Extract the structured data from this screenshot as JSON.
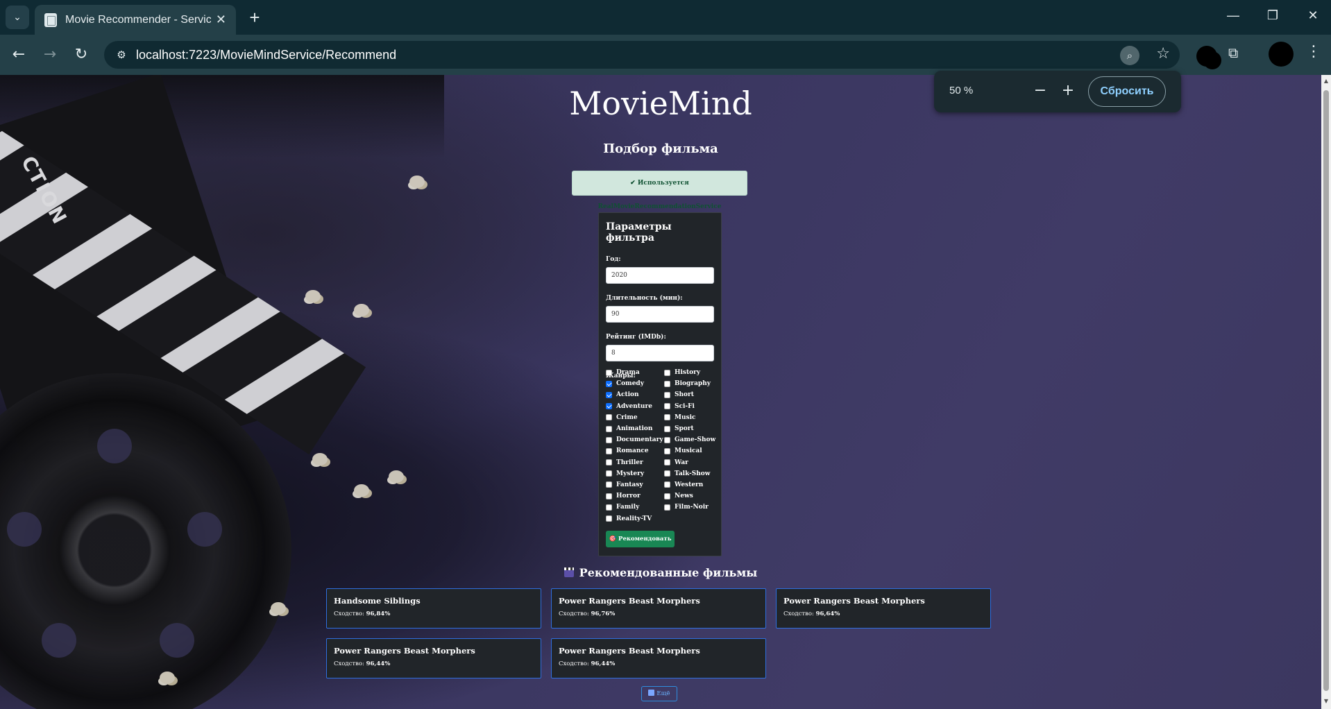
{
  "browser": {
    "tab_title": "Movie Recommender - ServiceS",
    "tab_close": "✕",
    "new_tab": "+",
    "url": "localhost:7223/MovieMindService/Recommend",
    "window": {
      "minimize": "—",
      "restore": "❐",
      "close": "✕"
    },
    "nav": {
      "back": "←",
      "forward": "→",
      "reload": "↻"
    },
    "zoom_popup": {
      "level": "50 %",
      "minus": "−",
      "plus": "+",
      "reset": "Сбросить"
    }
  },
  "page": {
    "app_title": "MovieMind",
    "section_title": "Подбор фильма",
    "service_note": "✔ Используется RealMovieRecommendationService",
    "filter": {
      "title": "Параметры фильтра",
      "year_label": "Год:",
      "year_value": "2020",
      "duration_label": "Длительность (мин):",
      "duration_value": "90",
      "rating_label": "Рейтинг (IMDb):",
      "rating_value": "8",
      "genres_label": "Жанры:",
      "genres_left": [
        {
          "name": "Drama",
          "checked": false
        },
        {
          "name": "Comedy",
          "checked": true
        },
        {
          "name": "Action",
          "checked": true
        },
        {
          "name": "Adventure",
          "checked": true
        },
        {
          "name": "Crime",
          "checked": false
        },
        {
          "name": "Animation",
          "checked": false
        },
        {
          "name": "Documentary",
          "checked": false
        },
        {
          "name": "Romance",
          "checked": false
        },
        {
          "name": "Thriller",
          "checked": false
        },
        {
          "name": "Mystery",
          "checked": false
        },
        {
          "name": "Fantasy",
          "checked": false
        },
        {
          "name": "Horror",
          "checked": false
        },
        {
          "name": "Family",
          "checked": false
        },
        {
          "name": "Reality-TV",
          "checked": false
        }
      ],
      "genres_right": [
        {
          "name": "History",
          "checked": false
        },
        {
          "name": "Biography",
          "checked": false
        },
        {
          "name": "Short",
          "checked": false
        },
        {
          "name": "Sci-Fi",
          "checked": false
        },
        {
          "name": "Music",
          "checked": false
        },
        {
          "name": "Sport",
          "checked": false
        },
        {
          "name": "Game-Show",
          "checked": false
        },
        {
          "name": "Musical",
          "checked": false
        },
        {
          "name": "War",
          "checked": false
        },
        {
          "name": "Talk-Show",
          "checked": false
        },
        {
          "name": "Western",
          "checked": false
        },
        {
          "name": "News",
          "checked": false
        },
        {
          "name": "Film-Noir",
          "checked": false
        }
      ],
      "recommend_button": "🎯 Рекомендовать"
    },
    "results": {
      "title": "Рекомендованные фильмы",
      "similarity_label": "Сходство:",
      "cards": [
        {
          "title": "Handsome Siblings",
          "similarity": "96,84%"
        },
        {
          "title": "Power Rangers Beast Morphers",
          "similarity": "96,76%"
        },
        {
          "title": "Power Rangers Beast Morphers",
          "similarity": "96,64%"
        },
        {
          "title": "Power Rangers Beast Morphers",
          "similarity": "96,44%"
        },
        {
          "title": "Power Rangers Beast Morphers",
          "similarity": "96,44%"
        }
      ],
      "more_button": "Ещё"
    }
  }
}
